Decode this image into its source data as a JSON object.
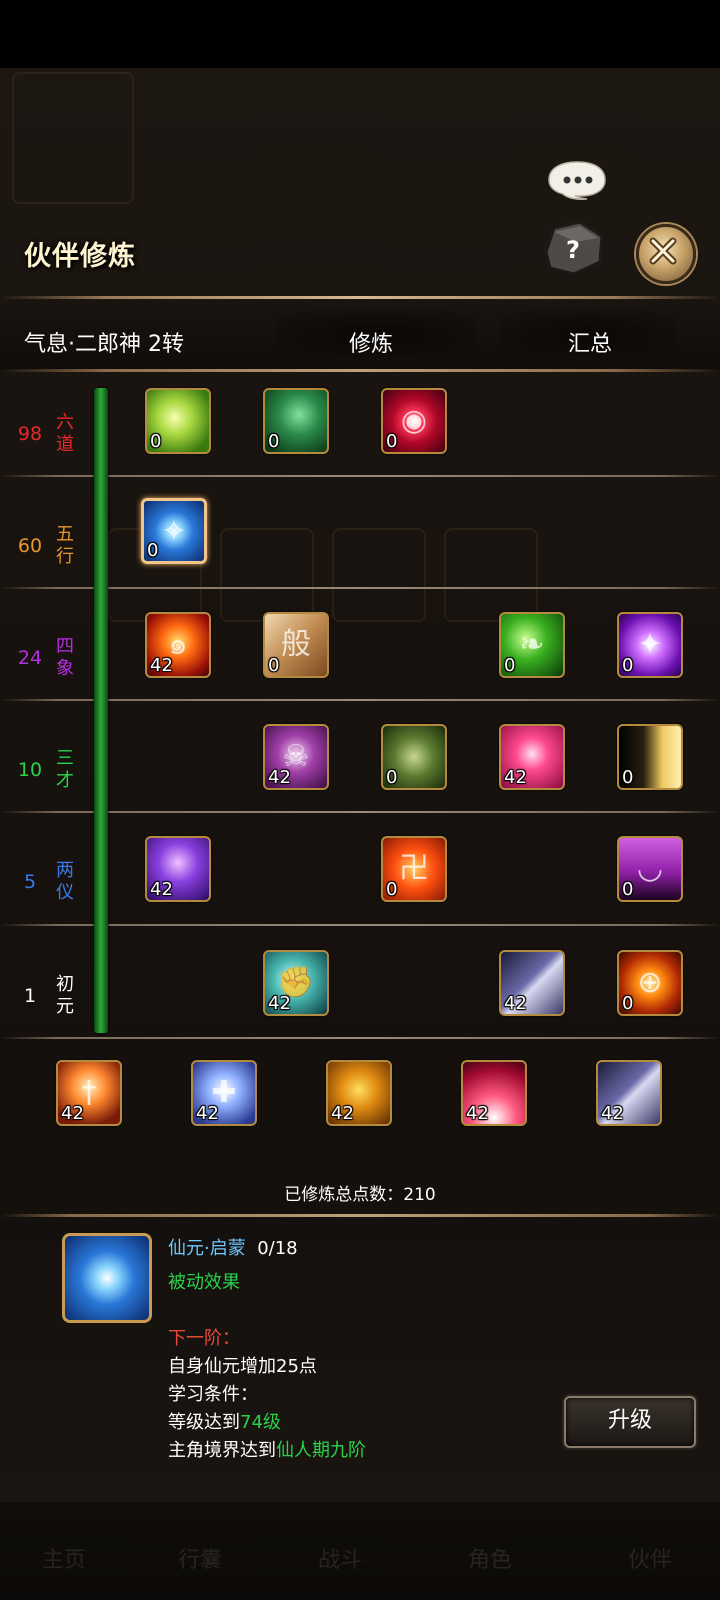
{
  "panel": {
    "title": "伙伴修炼",
    "help_icon": "question-stone-icon",
    "close_icon": "close-x-icon",
    "chat_icon": "speech-bubble-icon"
  },
  "tabs": {
    "partner": "气息·二郎神 2转",
    "train": "修炼",
    "summary": "汇总"
  },
  "tiers": [
    {
      "num": "98",
      "name": "六道",
      "color": "#e82a2a",
      "skills": [
        {
          "lvl": "0",
          "icon": "green-orb-icon"
        },
        {
          "lvl": "0",
          "icon": "green-shield-icon"
        },
        {
          "lvl": "0",
          "icon": "red-eye-icon"
        }
      ]
    },
    {
      "num": "60",
      "name": "五行",
      "color": "#e8962a",
      "skills": [
        {
          "lvl": "0",
          "icon": "blue-vortex-icon"
        }
      ]
    },
    {
      "num": "24",
      "name": "四象",
      "color": "#b430e0",
      "skills": [
        {
          "lvl": "42",
          "icon": "fire-swirl-icon"
        },
        {
          "lvl": "0",
          "icon": "scroll-icon"
        },
        {
          "lvl": "0",
          "icon": "green-leaf-icon"
        },
        {
          "lvl": "0",
          "icon": "purple-star-icon"
        }
      ]
    },
    {
      "num": "10",
      "name": "三才",
      "color": "#2ad24a",
      "skills": [
        {
          "lvl": "42",
          "icon": "skull-icon"
        },
        {
          "lvl": "0",
          "icon": "warrior-icon"
        },
        {
          "lvl": "42",
          "icon": "pink-body-icon"
        },
        {
          "lvl": "0",
          "icon": "shadow-figure-icon"
        }
      ]
    },
    {
      "num": "5",
      "name": "两仪",
      "color": "#3a7ae8",
      "skills": [
        {
          "lvl": "42",
          "icon": "purple-wings-icon"
        },
        {
          "lvl": "0",
          "icon": "flame-rune-icon"
        },
        {
          "lvl": "0",
          "icon": "purple-drop-icon"
        }
      ]
    },
    {
      "num": "1",
      "name": "初元",
      "color": "#ffffff",
      "skills": [
        {
          "lvl": "42",
          "icon": "arm-strength-icon"
        },
        {
          "lvl": "42",
          "icon": "wind-slash-icon"
        },
        {
          "lvl": "0",
          "icon": "crosshair-icon"
        }
      ]
    }
  ],
  "base_skills": [
    {
      "lvl": "42",
      "icon": "sword-fire-icon"
    },
    {
      "lvl": "42",
      "icon": "shield-cross-icon"
    },
    {
      "lvl": "42",
      "icon": "fire-demon-icon"
    },
    {
      "lvl": "42",
      "icon": "pink-burst-icon"
    },
    {
      "lvl": "42",
      "icon": "wind-slash-icon"
    }
  ],
  "total": "已修炼总点数：210",
  "detail": {
    "icon": "blue-vortex-icon",
    "name": "仙元·启蒙",
    "progress": "0/18",
    "type": "被动效果",
    "next_label": "下一阶：",
    "effect": "自身仙元增加25点",
    "cond_label": "学习条件：",
    "cond1_prefix": "等级达到",
    "cond1_value": "74级",
    "cond2_prefix": "主角境界达到",
    "cond2_value": "仙人期九阶"
  },
  "upgrade_button": "升级",
  "colors": {
    "gold_border": "#b48a3c",
    "accent_green": "#2ad24a",
    "accent_blue": "#6ec8ff",
    "accent_red": "#e84a3a"
  }
}
